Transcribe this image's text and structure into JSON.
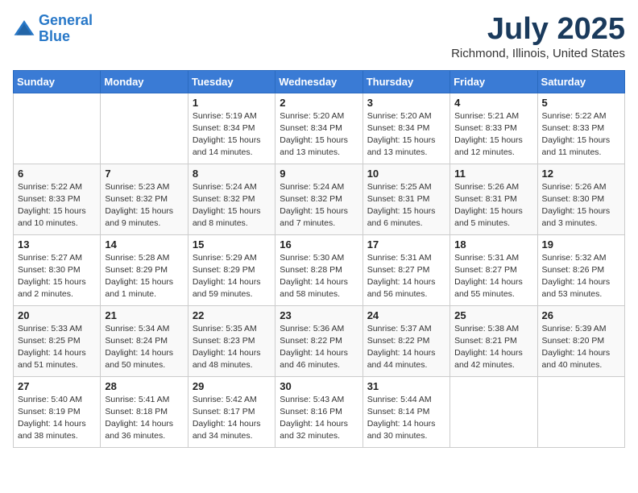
{
  "header": {
    "logo_line1": "General",
    "logo_line2": "Blue",
    "month_year": "July 2025",
    "location": "Richmond, Illinois, United States"
  },
  "days_of_week": [
    "Sunday",
    "Monday",
    "Tuesday",
    "Wednesday",
    "Thursday",
    "Friday",
    "Saturday"
  ],
  "weeks": [
    [
      {
        "day": "",
        "info": ""
      },
      {
        "day": "",
        "info": ""
      },
      {
        "day": "1",
        "info": "Sunrise: 5:19 AM\nSunset: 8:34 PM\nDaylight: 15 hours and 14 minutes."
      },
      {
        "day": "2",
        "info": "Sunrise: 5:20 AM\nSunset: 8:34 PM\nDaylight: 15 hours and 13 minutes."
      },
      {
        "day": "3",
        "info": "Sunrise: 5:20 AM\nSunset: 8:34 PM\nDaylight: 15 hours and 13 minutes."
      },
      {
        "day": "4",
        "info": "Sunrise: 5:21 AM\nSunset: 8:33 PM\nDaylight: 15 hours and 12 minutes."
      },
      {
        "day": "5",
        "info": "Sunrise: 5:22 AM\nSunset: 8:33 PM\nDaylight: 15 hours and 11 minutes."
      }
    ],
    [
      {
        "day": "6",
        "info": "Sunrise: 5:22 AM\nSunset: 8:33 PM\nDaylight: 15 hours and 10 minutes."
      },
      {
        "day": "7",
        "info": "Sunrise: 5:23 AM\nSunset: 8:32 PM\nDaylight: 15 hours and 9 minutes."
      },
      {
        "day": "8",
        "info": "Sunrise: 5:24 AM\nSunset: 8:32 PM\nDaylight: 15 hours and 8 minutes."
      },
      {
        "day": "9",
        "info": "Sunrise: 5:24 AM\nSunset: 8:32 PM\nDaylight: 15 hours and 7 minutes."
      },
      {
        "day": "10",
        "info": "Sunrise: 5:25 AM\nSunset: 8:31 PM\nDaylight: 15 hours and 6 minutes."
      },
      {
        "day": "11",
        "info": "Sunrise: 5:26 AM\nSunset: 8:31 PM\nDaylight: 15 hours and 5 minutes."
      },
      {
        "day": "12",
        "info": "Sunrise: 5:26 AM\nSunset: 8:30 PM\nDaylight: 15 hours and 3 minutes."
      }
    ],
    [
      {
        "day": "13",
        "info": "Sunrise: 5:27 AM\nSunset: 8:30 PM\nDaylight: 15 hours and 2 minutes."
      },
      {
        "day": "14",
        "info": "Sunrise: 5:28 AM\nSunset: 8:29 PM\nDaylight: 15 hours and 1 minute."
      },
      {
        "day": "15",
        "info": "Sunrise: 5:29 AM\nSunset: 8:29 PM\nDaylight: 14 hours and 59 minutes."
      },
      {
        "day": "16",
        "info": "Sunrise: 5:30 AM\nSunset: 8:28 PM\nDaylight: 14 hours and 58 minutes."
      },
      {
        "day": "17",
        "info": "Sunrise: 5:31 AM\nSunset: 8:27 PM\nDaylight: 14 hours and 56 minutes."
      },
      {
        "day": "18",
        "info": "Sunrise: 5:31 AM\nSunset: 8:27 PM\nDaylight: 14 hours and 55 minutes."
      },
      {
        "day": "19",
        "info": "Sunrise: 5:32 AM\nSunset: 8:26 PM\nDaylight: 14 hours and 53 minutes."
      }
    ],
    [
      {
        "day": "20",
        "info": "Sunrise: 5:33 AM\nSunset: 8:25 PM\nDaylight: 14 hours and 51 minutes."
      },
      {
        "day": "21",
        "info": "Sunrise: 5:34 AM\nSunset: 8:24 PM\nDaylight: 14 hours and 50 minutes."
      },
      {
        "day": "22",
        "info": "Sunrise: 5:35 AM\nSunset: 8:23 PM\nDaylight: 14 hours and 48 minutes."
      },
      {
        "day": "23",
        "info": "Sunrise: 5:36 AM\nSunset: 8:22 PM\nDaylight: 14 hours and 46 minutes."
      },
      {
        "day": "24",
        "info": "Sunrise: 5:37 AM\nSunset: 8:22 PM\nDaylight: 14 hours and 44 minutes."
      },
      {
        "day": "25",
        "info": "Sunrise: 5:38 AM\nSunset: 8:21 PM\nDaylight: 14 hours and 42 minutes."
      },
      {
        "day": "26",
        "info": "Sunrise: 5:39 AM\nSunset: 8:20 PM\nDaylight: 14 hours and 40 minutes."
      }
    ],
    [
      {
        "day": "27",
        "info": "Sunrise: 5:40 AM\nSunset: 8:19 PM\nDaylight: 14 hours and 38 minutes."
      },
      {
        "day": "28",
        "info": "Sunrise: 5:41 AM\nSunset: 8:18 PM\nDaylight: 14 hours and 36 minutes."
      },
      {
        "day": "29",
        "info": "Sunrise: 5:42 AM\nSunset: 8:17 PM\nDaylight: 14 hours and 34 minutes."
      },
      {
        "day": "30",
        "info": "Sunrise: 5:43 AM\nSunset: 8:16 PM\nDaylight: 14 hours and 32 minutes."
      },
      {
        "day": "31",
        "info": "Sunrise: 5:44 AM\nSunset: 8:14 PM\nDaylight: 14 hours and 30 minutes."
      },
      {
        "day": "",
        "info": ""
      },
      {
        "day": "",
        "info": ""
      }
    ]
  ]
}
